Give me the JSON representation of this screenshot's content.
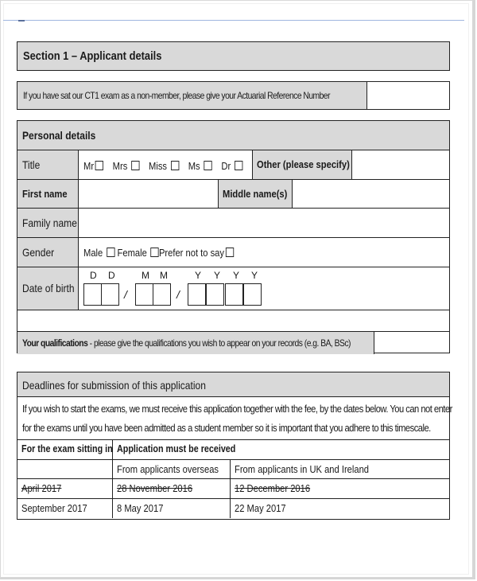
{
  "section1": {
    "title": "Section 1 – Applicant details"
  },
  "actuarial_reference": {
    "label": "If you have sat our CT1 exam as a non-member, please give your Actuarial Reference Number",
    "value": ""
  },
  "personal_details": {
    "heading": "Personal details",
    "title_label": "Title",
    "title_options": [
      "Mr",
      "Mrs",
      "Miss",
      "Ms",
      "Dr"
    ],
    "other_label": "Other (please specify)",
    "other_value": "",
    "first_name_label": "First name",
    "first_name_value": "",
    "middle_names_label": "Middle name(s)",
    "middle_names_value": "",
    "family_name_label": "Family name",
    "family_name_value": "",
    "gender_label": "Gender",
    "gender_options": [
      "Male",
      "Female",
      "Prefer not to say"
    ],
    "dob_label": "Date of birth",
    "dob_letters": [
      "D",
      "D",
      "M",
      "M",
      "Y",
      "Y",
      "Y",
      "Y"
    ],
    "dob_separator": "/",
    "qualifications_label_bold": "Your qualifications",
    "qualifications_label_rest": " - please give the qualifications you wish to appear on your records (e.g. BA, BSc)",
    "qualifications_value": ""
  },
  "deadlines": {
    "heading": "Deadlines for submission of this application",
    "intro_line1": "If you wish to start the exams, we must receive this application together with the fee, by the dates below.  You can not enter",
    "intro_line2": "for the exams until you have been admitted as a student member so it is important that you adhere to this timescale.",
    "col_sitting": "For the exam sitting in",
    "col_received": "Application must be received",
    "sub_overseas": "From applicants overseas",
    "sub_uk": "From applicants in UK and Ireland",
    "rows": [
      {
        "sitting": "April 2017",
        "overseas": "28 November 2016",
        "uk": "12 December 2016",
        "struck": true
      },
      {
        "sitting": "September 2017",
        "overseas": "8 May 2017",
        "uk": "22 May 2017",
        "struck": false
      }
    ]
  }
}
